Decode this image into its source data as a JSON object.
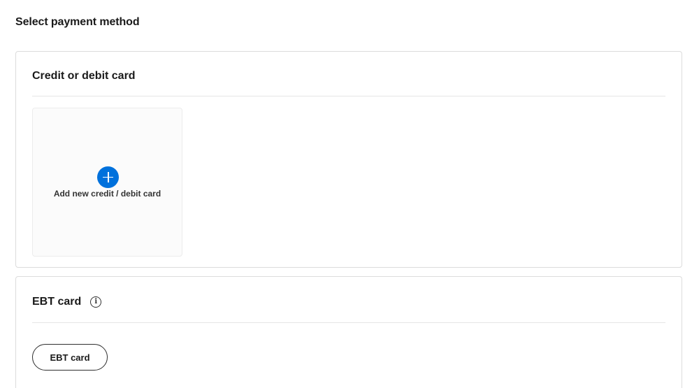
{
  "page": {
    "title": "Select payment method"
  },
  "credit_section": {
    "title": "Credit or debit card",
    "add_card_label": "Add new credit / debit card",
    "add_icon": "plus-circle-icon",
    "accent_color": "#0071dc"
  },
  "ebt_section": {
    "title": "EBT card",
    "info_icon": "info-icon",
    "info_glyph": "i",
    "button_label": "EBT card"
  }
}
